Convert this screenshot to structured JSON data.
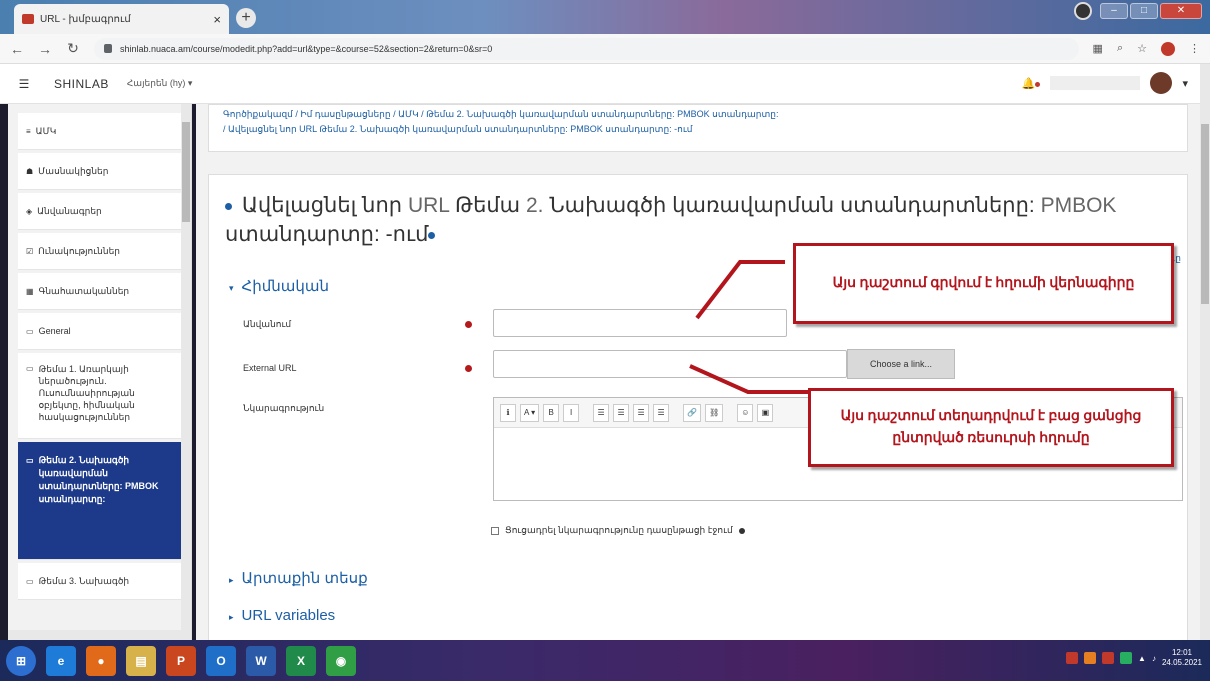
{
  "browser": {
    "tab_title": "URL - խմբագրում",
    "url": "shinlab.nuaca.am/course/modedit.php?add=url&type=&course=52&section=2&return=0&sr=0"
  },
  "topnav": {
    "brand": "SHINLAB",
    "language": "Հայերեն (hy) ▾"
  },
  "sidebar": {
    "items": [
      {
        "icon": "≡",
        "label": "ԱՄԿ"
      },
      {
        "icon": "☗",
        "label": "Մասնակիցներ"
      },
      {
        "icon": "◈",
        "label": "Անվանագրեր"
      },
      {
        "icon": "☑",
        "label": "Ունակություններ"
      },
      {
        "icon": "▦",
        "label": "Գնահատականներ"
      },
      {
        "icon": "▭",
        "label": "General"
      },
      {
        "icon": "▭",
        "label": "Թեմա 1. Առարկայի ներածություն. Ուսումնասիրության օբյեկտը, հիմնական հասկացություններ"
      },
      {
        "icon": "▭",
        "label": "Թեմա 2. Նախագծի կառավարման ստանդարտները: PMBOK ստանդարտը:"
      },
      {
        "icon": "▭",
        "label": "Թեմա 3. Նախագծի"
      }
    ]
  },
  "breadcrumb": {
    "line1": "Գործիքակազմ / Իմ դասընթացները / ԱՄԿ / Թեմա 2. Նախագծի կառավարման ստանդարտները: PMBOK ստանդարտը:",
    "line2": "/ Ավելացնել նոր URL Թեմա 2. Նախագծի կառավարման ստանդարտները: PMBOK ստանդարտը: -ում"
  },
  "heading": {
    "part1": "Ավելացնել նոր",
    "part2": "URL",
    "part3": "Թեմա",
    "part4": "2.",
    "part5": "Նախագծի կառավարման ստանդարտները:",
    "part6": "PMBOK",
    "part7": "ստանդարտը:",
    "part8": "-ում"
  },
  "expand_all": "...ը",
  "form": {
    "section_general": "Հիմնական",
    "name_label": "Անվանում",
    "name_value": "",
    "external_url_label": "External URL",
    "external_url_value": "",
    "choose_link_button": "Choose a link...",
    "description_label": "Նկարագրություն",
    "toolbar": [
      "ℹ",
      "A ▾",
      "B",
      "I",
      "☰",
      "☰",
      "☰",
      "☰",
      "🔗",
      "⛓",
      "☺",
      "▣"
    ],
    "show_description_label": "Ցուցադրել նկարագրությունը դասընթացի էջում",
    "section_appearance": "Արտաքին տեսք",
    "section_url_variables": "URL variables"
  },
  "callouts": {
    "name_note": "Այս դաշտում գրվում է հղումի վերնագիրը",
    "url_note": "Այս դաշտում տեղադրվում է բաց ցանցից ընտրված ռեսուրսի հղումը"
  },
  "taskbar": {
    "apps": [
      {
        "name": "ie",
        "label": "e",
        "color": "#1e7bd8"
      },
      {
        "name": "firefox",
        "label": "●",
        "color": "#e06a1a"
      },
      {
        "name": "explorer",
        "label": "▤",
        "color": "#d7b24a"
      },
      {
        "name": "powerpoint",
        "label": "P",
        "color": "#c9461f"
      },
      {
        "name": "outlook",
        "label": "O",
        "color": "#1f6fc9"
      },
      {
        "name": "word",
        "label": "W",
        "color": "#2a5aa8"
      },
      {
        "name": "excel",
        "label": "X",
        "color": "#1f8a4a"
      },
      {
        "name": "chrome",
        "label": "◉",
        "color": "#2f9e44"
      }
    ],
    "time": "12:01",
    "date": "24.05.2021"
  },
  "colors": {
    "accent": "#1d5fa5",
    "active_nav": "#1d3a8a",
    "callout_red": "#b3151c",
    "required": "#b51a1a"
  }
}
